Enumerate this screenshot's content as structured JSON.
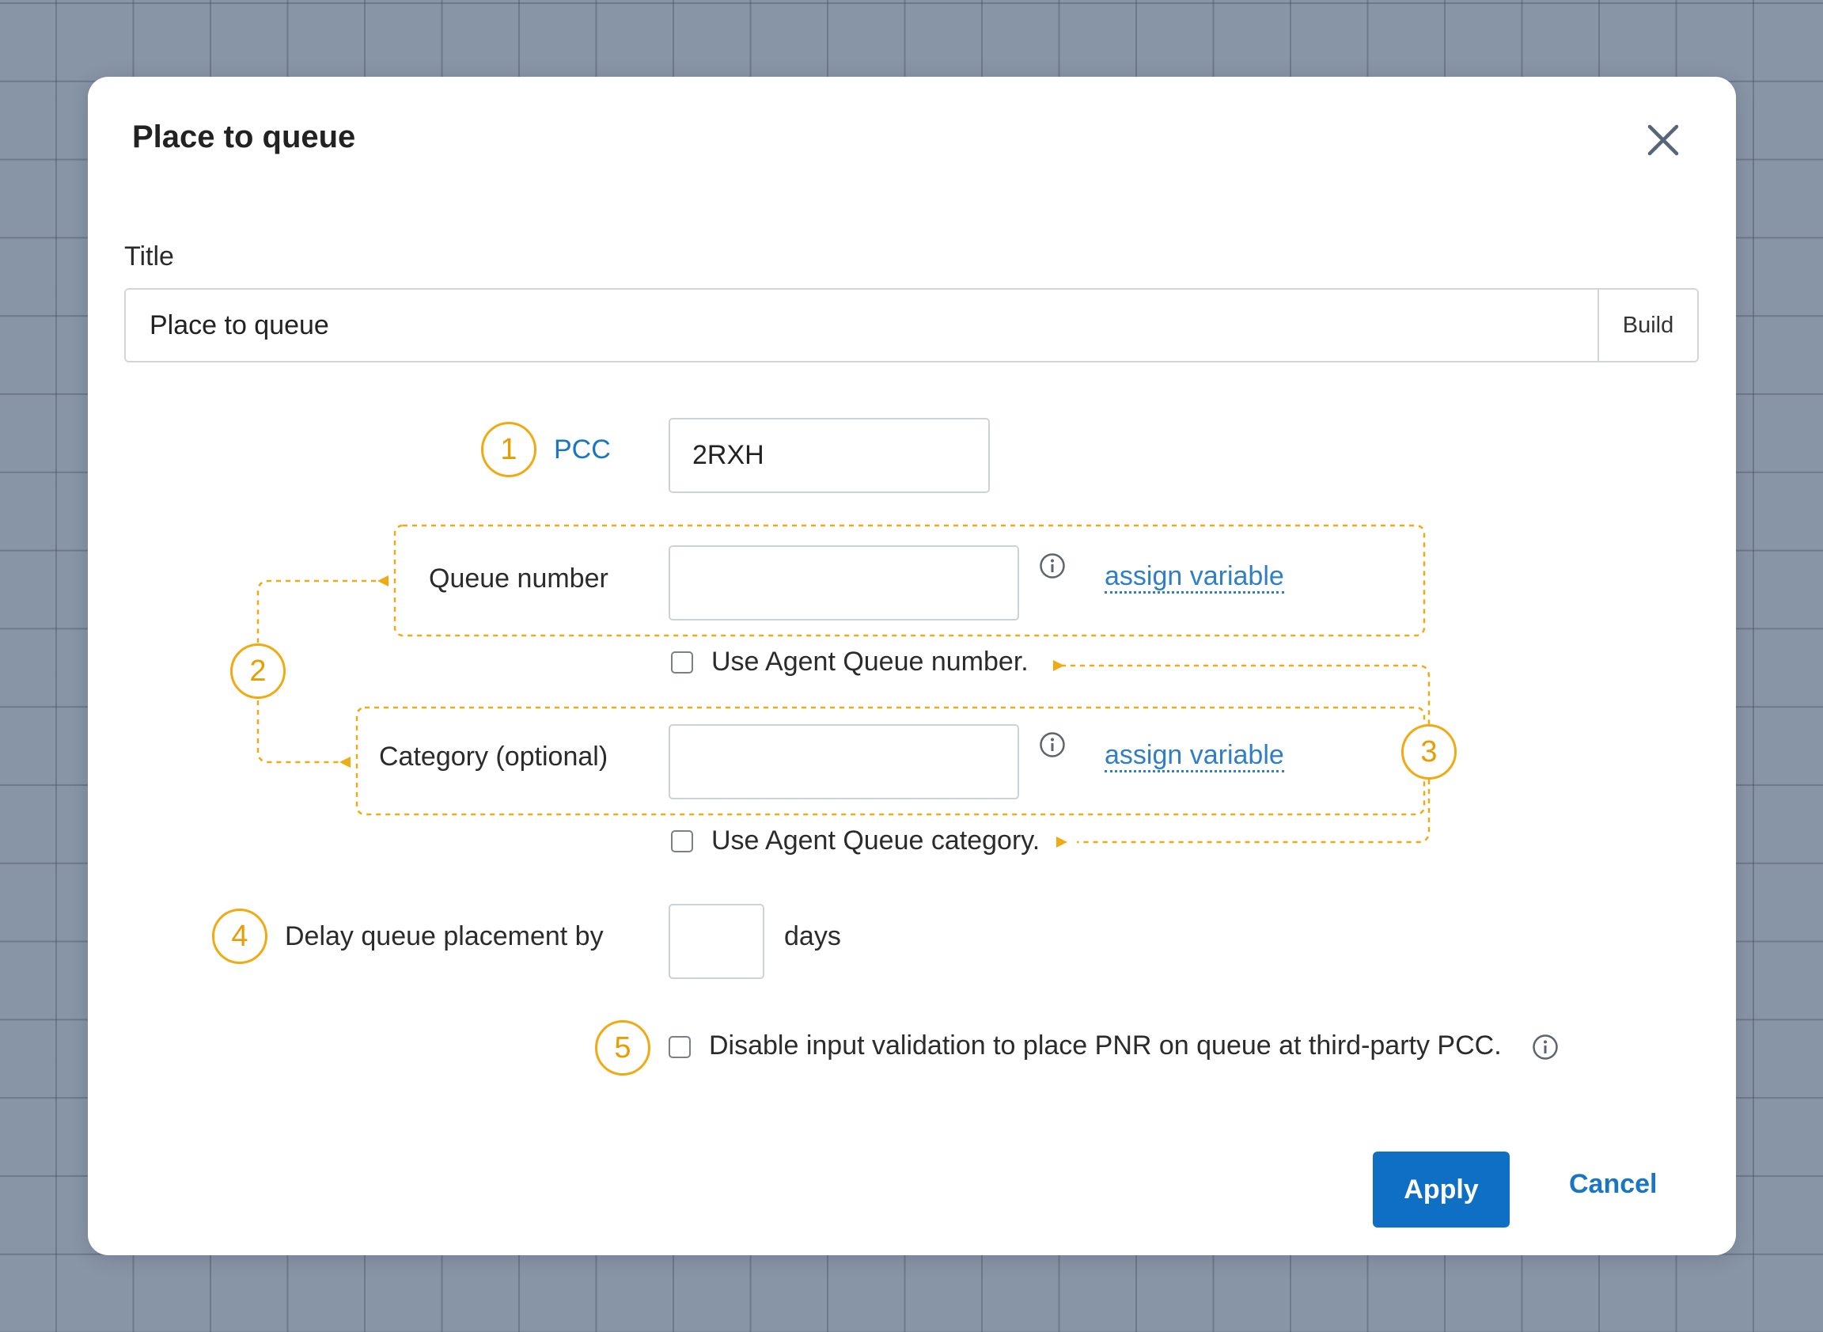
{
  "dialog": {
    "title": "Place to queue",
    "close_icon": "close-icon"
  },
  "title_field": {
    "label": "Title",
    "value": "Place to queue",
    "build_label": "Build"
  },
  "pcc": {
    "badge": "1",
    "label": "PCC",
    "value": "2RXH"
  },
  "queue_number": {
    "label": "Queue number",
    "value": "",
    "info_icon": "info-icon",
    "assign_label": "assign variable",
    "checkbox_label": "Use Agent Queue number.",
    "checked": false
  },
  "category": {
    "label": "Category (optional)",
    "value": "",
    "info_icon": "info-icon",
    "assign_label": "assign variable",
    "checkbox_label": "Use Agent Queue category.",
    "checked": false
  },
  "annotations": {
    "group_badge": "2",
    "agent_badge": "3",
    "accent_color": "#f0aa12"
  },
  "delay": {
    "badge": "4",
    "label": "Delay queue placement by",
    "value": "",
    "unit": "days"
  },
  "validation": {
    "badge": "5",
    "label": "Disable input validation to place PNR on queue at third-party PCC.",
    "checked": false,
    "info_icon": "info-icon"
  },
  "footer": {
    "apply_label": "Apply",
    "cancel_label": "Cancel",
    "primary_color": "#0e6fc4"
  }
}
